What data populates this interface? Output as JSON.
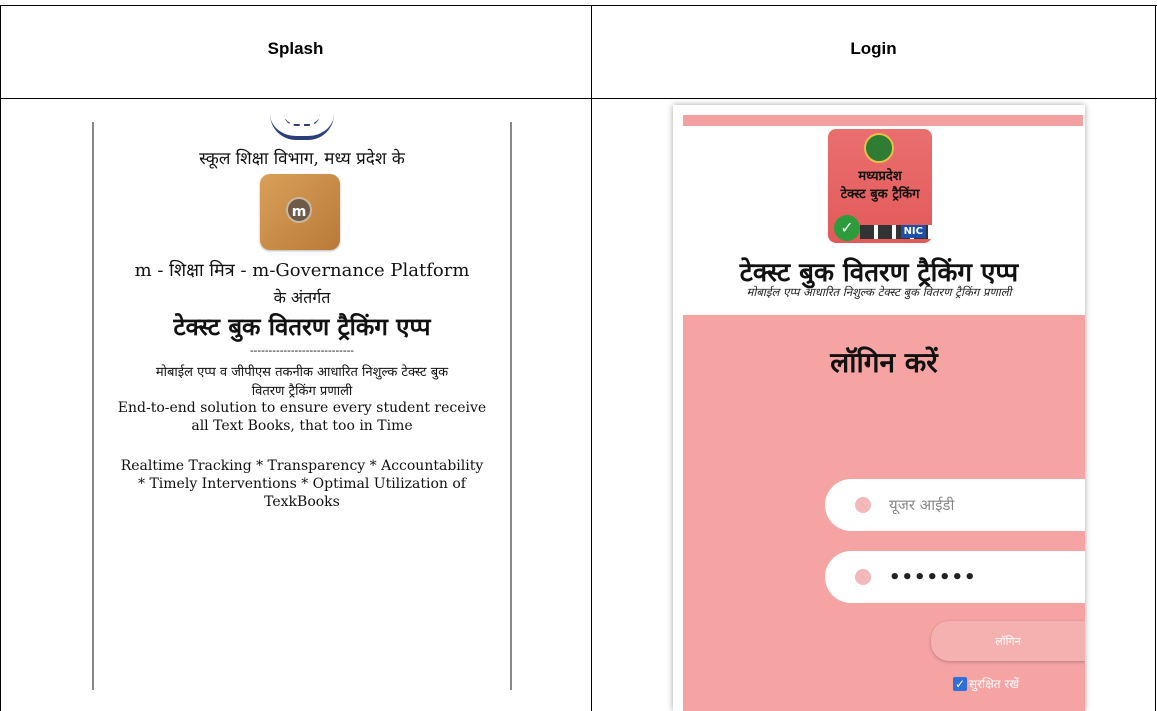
{
  "headers": {
    "splash": "Splash",
    "login": "Login"
  },
  "splash": {
    "dept_line": "स्कूल  शिक्षा विभाग, मध्य प्रदेश के",
    "logo_icon": "m-shiksha-mitra-logo",
    "platform_line": "m - शिक्षा मित्र  - m-Governance Platform",
    "under_line": "के अंतर्गत",
    "app_title": "टेक्स्ट बुक वितरण ट्रैकिंग एप्प",
    "divider": "----------------------------",
    "tagline_hi_1": "मोबाईल एप्प व जीपीएस  तकनीक  आधारित  निशुल्क टेक्स्ट बुक",
    "tagline_hi_2": "वितरण ट्रैकिंग प्रणाली",
    "tagline_en_1": "End-to-end solution to ensure every student receive",
    "tagline_en_2": "all Text Books, that too in Time",
    "features_1": "Realtime Tracking  * Transparency * Accountability",
    "features_2": "* Timely Interventions  * Optimal Utilization of",
    "features_3": "TexkBooks"
  },
  "login": {
    "logo": {
      "line1": "मध्यप्रदेश",
      "line2": "टेक्स्ट बुक ट्रैकिंग",
      "badge": "NIC"
    },
    "title": "टेक्स्ट बुक वितरण ट्रैकिंग एप्प",
    "subtitle": "मोबाईल एप्प आधारित  निशुल्क टेक्स्ट बुक वितरण ट्रैकिंग प्रणाली",
    "panel_heading": "लॉगिन करें",
    "user_placeholder": "यूजर आईडी",
    "password_value": "•••••••",
    "login_button": "लॉगिन",
    "remember_label": "सुरक्षित रखें",
    "remember_checked": true
  }
}
